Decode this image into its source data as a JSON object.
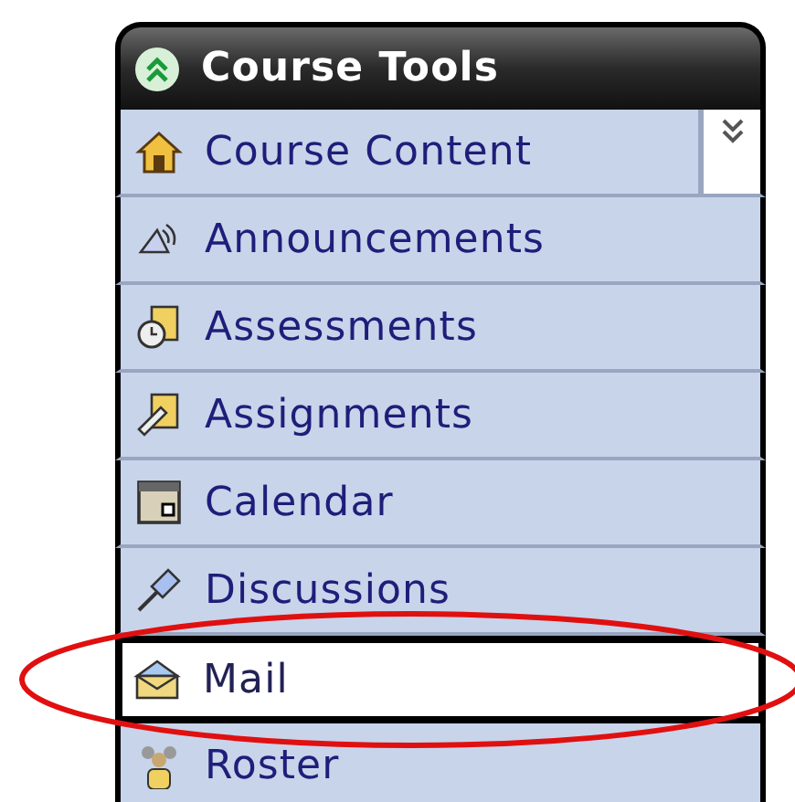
{
  "panel": {
    "title": "Course Tools",
    "collapsed": false
  },
  "items": [
    {
      "label": "Course Content",
      "kind": "house",
      "selected": false,
      "menu_toggle": true
    },
    {
      "label": "Announcements",
      "kind": "speaker",
      "selected": false,
      "menu_toggle": false
    },
    {
      "label": "Assessments",
      "kind": "clock",
      "selected": false,
      "menu_toggle": false
    },
    {
      "label": "Assignments",
      "kind": "ruler",
      "selected": false,
      "menu_toggle": false
    },
    {
      "label": "Calendar",
      "kind": "calendar",
      "selected": false,
      "menu_toggle": false
    },
    {
      "label": "Discussions",
      "kind": "pin",
      "selected": false,
      "menu_toggle": false
    },
    {
      "label": "Mail",
      "kind": "envelope",
      "selected": true,
      "menu_toggle": false
    },
    {
      "label": "Roster",
      "kind": "people",
      "selected": false,
      "menu_toggle": false
    }
  ]
}
